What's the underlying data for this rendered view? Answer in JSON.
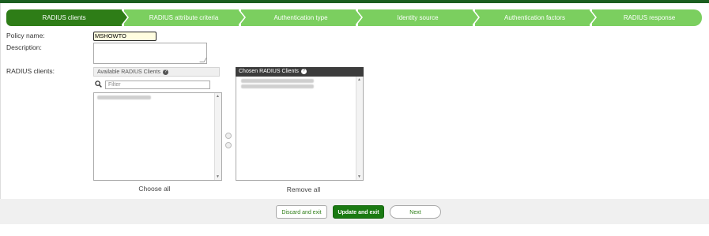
{
  "wizard": {
    "steps": [
      {
        "label": "RADIUS clients",
        "active": true
      },
      {
        "label": "RADIUS attribute criteria",
        "active": false
      },
      {
        "label": "Authentication type",
        "active": false
      },
      {
        "label": "Identity source",
        "active": false
      },
      {
        "label": "Authentication factors",
        "active": false
      },
      {
        "label": "RADIUS response",
        "active": false
      }
    ]
  },
  "form": {
    "policy_name_label": "Policy name:",
    "policy_name_value": "MSHOWTO",
    "description_label": "Description:",
    "description_value": "",
    "radius_clients_label": "RADIUS clients:"
  },
  "available": {
    "heading": "Available RADIUS Clients",
    "help_icon": "?",
    "filter_placeholder": "Filter",
    "choose_all": "Choose all"
  },
  "chosen": {
    "heading": "Chosen RADIUS Clients",
    "help_icon": "?",
    "remove_all": "Remove all"
  },
  "footer": {
    "discard_label": "Discard and exit",
    "update_label": "Update and exit",
    "next_label": "Next"
  },
  "colors": {
    "active_step": "#2e7d17",
    "inactive_step": "#7bcf5f",
    "primary_button": "#1a7a12"
  }
}
